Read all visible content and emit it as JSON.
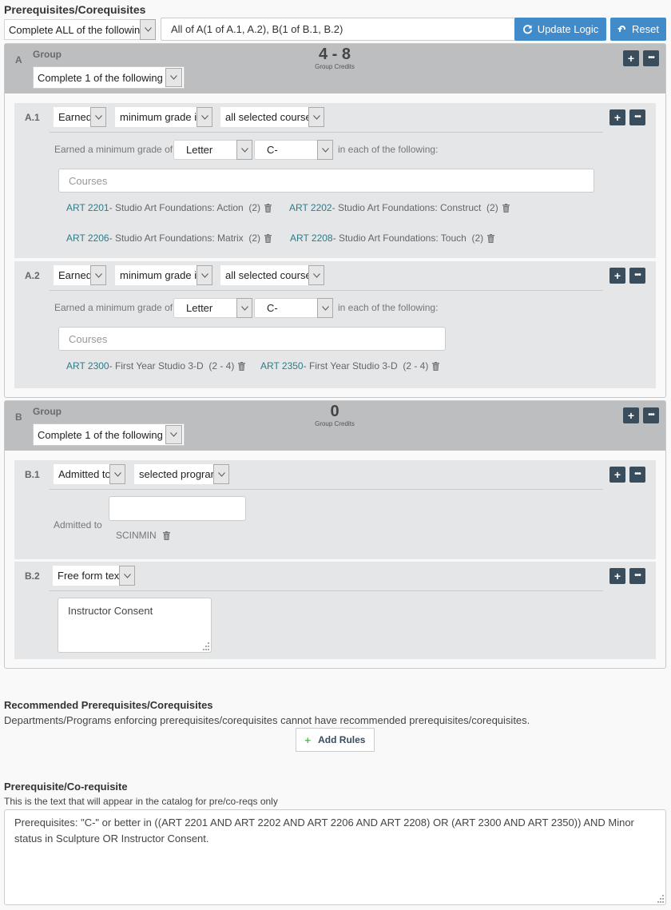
{
  "header": {
    "title": "Prerequisites/Corequisites",
    "logic_select": "Complete ALL of the following",
    "logic_text": "All of A(1 of A.1, A.2), B(1 of B.1, B.2)",
    "update_logic_label": "Update Logic",
    "reset_label": "Reset"
  },
  "groups": {
    "a": {
      "id": "A",
      "title": "Group",
      "select": "Complete 1 of the following",
      "credits": "4 - 8",
      "credits_label": "Group Credits",
      "rules": {
        "a1": {
          "id": "A.1",
          "type": "Earned",
          "condition": "minimum grade in",
          "scope": "all selected courses",
          "grade_prefix": "Earned a minimum grade of",
          "grade_type": "Letter",
          "grade_value": "C-",
          "grade_suffix": "in each of the following:",
          "courses_placeholder": "Courses",
          "courses": [
            {
              "code": "ART 2201",
              "title": " - Studio Art Foundations: Action",
              "credits": "(2)"
            },
            {
              "code": "ART 2202",
              "title": " - Studio Art Foundations: Construct",
              "credits": "(2)"
            },
            {
              "code": "ART 2206",
              "title": " - Studio Art Foundations: Matrix",
              "credits": "(2)"
            },
            {
              "code": "ART 2208",
              "title": " - Studio Art Foundations: Touch",
              "credits": "(2)"
            }
          ]
        },
        "a2": {
          "id": "A.2",
          "type": "Earned",
          "condition": "minimum grade in",
          "scope": "all selected courses",
          "grade_prefix": "Earned a minimum grade of",
          "grade_type": "Letter",
          "grade_value": "C-",
          "grade_suffix": "in each of the following:",
          "courses_placeholder": "Courses",
          "courses": [
            {
              "code": "ART 2300",
              "title": " - First Year Studio 3-D",
              "credits": "(2 - 4)"
            },
            {
              "code": "ART 2350",
              "title": " - First Year Studio 3-D",
              "credits": "(2 - 4)"
            }
          ]
        }
      }
    },
    "b": {
      "id": "B",
      "title": "Group",
      "select": "Complete 1 of the following",
      "credits": "0",
      "credits_label": "Group Credits",
      "rules": {
        "b1": {
          "id": "B.1",
          "type": "Admitted to",
          "condition": "selected program",
          "label": "Admitted to",
          "input_value": "",
          "program": "SCINMIN"
        },
        "b2": {
          "id": "B.2",
          "type": "Free form text",
          "text": "Instructor Consent"
        }
      }
    }
  },
  "recommended": {
    "title": "Recommended Prerequisites/Corequisites",
    "note": "Departments/Programs enforcing prerequisites/corequisites cannot have recommended prerequisites/corequisites.",
    "add_rules_label": "Add Rules"
  },
  "catalog": {
    "title": "Prerequisite/Co-requisite",
    "note": "This is the text that will appear in the catalog for pre/co-reqs only",
    "text": "Prerequisites: \"C-\" or better in ((ART 2201 AND ART 2202 AND ART 2206 AND ART 2208) OR (ART 2300 AND ART 2350)) AND Minor status in Sculpture OR Instructor Consent."
  },
  "colors": {
    "primary_button": "#428bca",
    "icon_button": "#3a4d5c",
    "course_link": "#2d7c8a",
    "group_header": "#bdbebf",
    "add_icon": "#5cb85c"
  }
}
